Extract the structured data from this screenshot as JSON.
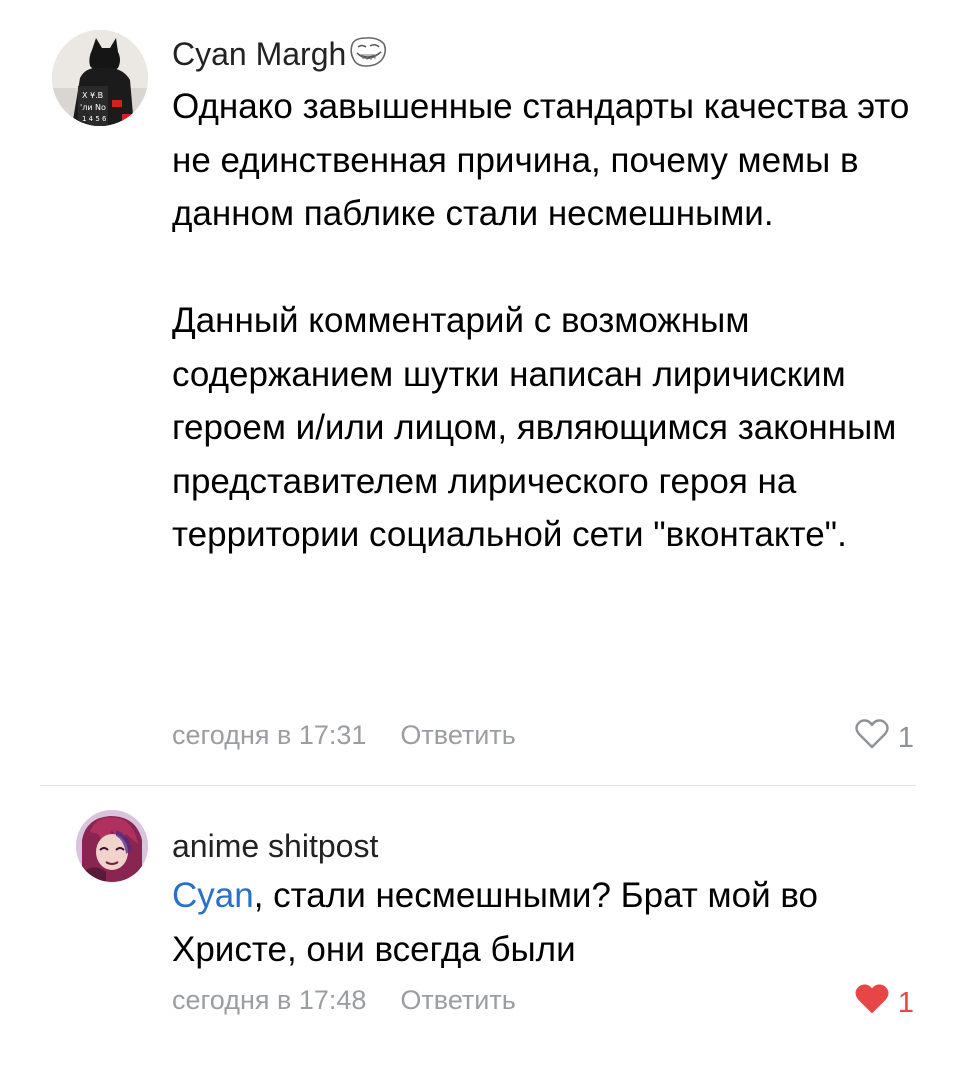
{
  "comments": [
    {
      "author": "Cyan Margh",
      "author_badge_icon": "trollface-icon",
      "paragraphs": [
        "Однако завышенные стандарты качества это не единственная причина, почему мемы в данном паблике стали несмешными.",
        "Данный комментарий с возможным содержанием шутки написан лиричиским героем и/или лицом, являющимся законным представителем лирического героя на территории социальной сети \"вконтакте\"."
      ],
      "timestamp": "сегодня в 17:31",
      "reply_label": "Ответить",
      "likes": "1",
      "liked": false
    },
    {
      "author": "anime shitpost",
      "mention": "Cyan",
      "text": ", стали несмешными? Брат мой во Христе, они всегда были",
      "timestamp": "сегодня в 17:48",
      "reply_label": "Ответить",
      "likes": "1",
      "liked": true
    }
  ],
  "colors": {
    "mention": "#2a6fc9",
    "meta": "#9a9ea3",
    "like_active": "#e64646",
    "divider": "#e3e4e6"
  }
}
